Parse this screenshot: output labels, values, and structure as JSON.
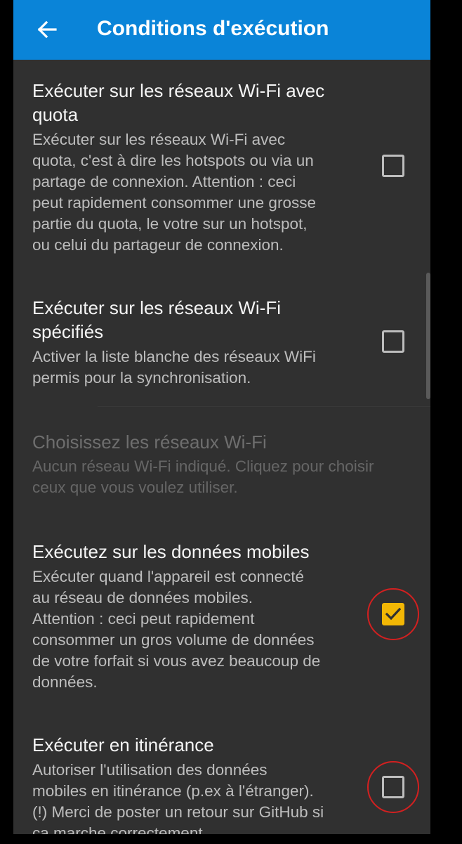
{
  "appbar": {
    "title": "Conditions d'exécution",
    "back_icon": "arrow-left-icon",
    "color": "#0a84d8"
  },
  "preferences": [
    {
      "title_lines": [
        "Exécuter sur les réseaux Wi-Fi avec",
        "quota"
      ],
      "summary_lines": [
        "Exécuter sur les réseaux Wi-Fi avec",
        "quota, c'est à dire les hotspots ou via un",
        "partage de connexion. Attention : ceci",
        "peut rapidement consommer une grosse",
        "partie du quota, le votre sur un hotspot,",
        "ou celui du partageur de connexion."
      ],
      "checked": false,
      "enabled": true
    },
    {
      "title_lines": [
        "Exécuter sur les réseaux Wi-Fi",
        "spécifiés"
      ],
      "summary_lines": [
        "Activer la liste blanche des réseaux WiFi",
        "permis pour la synchronisation."
      ],
      "checked": false,
      "enabled": true
    },
    {
      "title_lines": [
        "Choisissez les réseaux Wi-Fi"
      ],
      "summary_lines": [
        "Aucun réseau Wi-Fi indiqué. Cliquez pour choisir",
        "ceux que vous voulez utiliser."
      ],
      "enabled": false
    },
    {
      "title_lines": [
        "Exécutez sur les données mobiles"
      ],
      "summary_lines": [
        "Exécuter quand l'appareil est connecté",
        "au réseau de données mobiles.",
        "Attention : ceci peut rapidement",
        "consommer un gros volume de données",
        "de votre forfait si vous avez beaucoup de",
        "données."
      ],
      "checked": true,
      "enabled": true
    },
    {
      "title_lines": [
        "Exécuter en itinérance"
      ],
      "summary_lines": [
        "Autoriser l'utilisation des données",
        "mobiles en itinérance (p.ex à l'étranger).",
        "(!) Merci de poster un retour sur GitHub si",
        "ça marche correctement."
      ],
      "checked": false,
      "enabled": true
    }
  ],
  "colors": {
    "background": "#303030",
    "checkbox_checked": "#f2b705",
    "highlight_ring": "#d32020"
  }
}
